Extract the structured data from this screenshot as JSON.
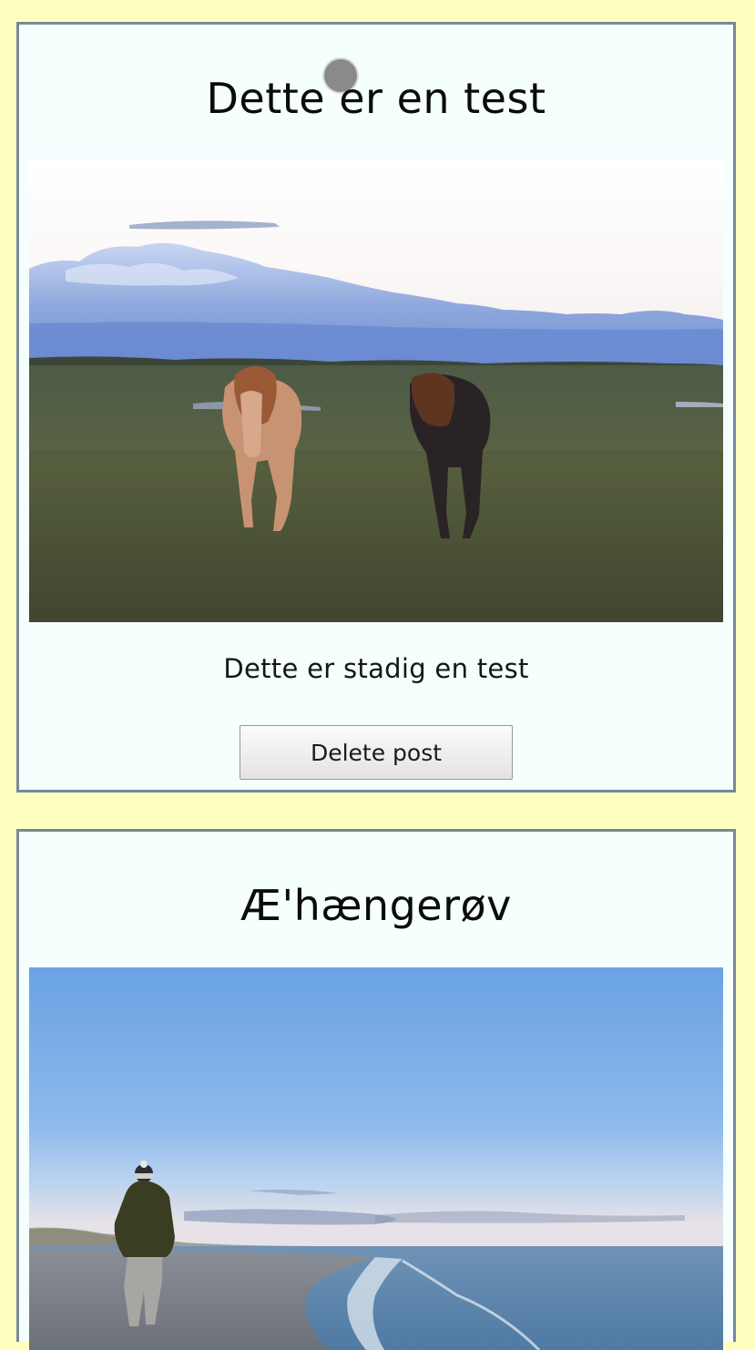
{
  "posts": [
    {
      "title": "Dette er en test",
      "image_alt": "Two horses on a grassy field under a cloudy sky",
      "caption": "Dette er stadig en test",
      "delete_label": "Delete post"
    },
    {
      "title": "Æ'hængerøv",
      "image_alt": "Person walking on a beach by the sea"
    }
  ],
  "colors": {
    "page_background": "#ffffc0",
    "card_background": "#f4fffe",
    "card_border": "#778899"
  },
  "icons": {
    "loading": "loading-spinner-icon"
  }
}
